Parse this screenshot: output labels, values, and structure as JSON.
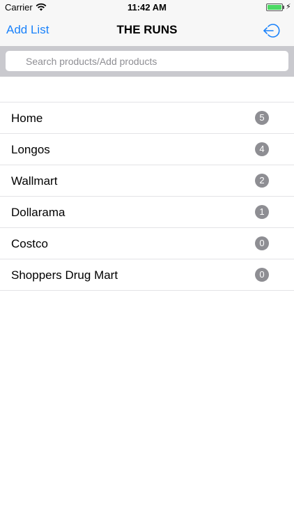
{
  "status_bar": {
    "carrier": "Carrier",
    "time": "11:42 AM",
    "battery_level": 1.0,
    "charging": true
  },
  "nav": {
    "add_list_label": "Add List",
    "title": "THE RUNS",
    "right_icon": "logout-icon"
  },
  "search": {
    "value": "",
    "placeholder": "Search products/Add products"
  },
  "lists": [
    {
      "name": "Home",
      "count": "5"
    },
    {
      "name": "Longos",
      "count": "4"
    },
    {
      "name": "Wallmart",
      "count": "2"
    },
    {
      "name": "Dollarama",
      "count": "1"
    },
    {
      "name": "Costco",
      "count": "0"
    },
    {
      "name": "Shoppers Drug Mart",
      "count": "0"
    }
  ],
  "colors": {
    "accent": "#1a82fb",
    "badge": "#8e8e93",
    "battery": "#4cd964"
  }
}
